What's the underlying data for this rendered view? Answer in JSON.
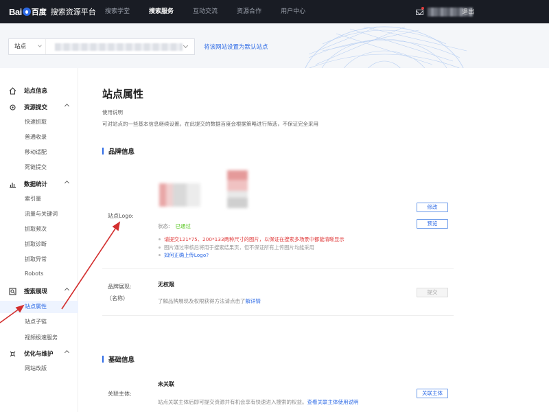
{
  "topbar": {
    "logo_bai": "Bai",
    "logo_baidu": "百度",
    "platform": "搜索资源平台",
    "nav": [
      "搜索学堂",
      "搜索服务",
      "互动交流",
      "资源合作",
      "用户中心"
    ],
    "active_nav_index": 1,
    "logout": "退出"
  },
  "sitebar": {
    "site_label": "站点",
    "set_default": "将该网站设置为默认站点"
  },
  "sidebar": {
    "site_info": "站点信息",
    "resource_submit": "资源提交",
    "resource_items": [
      "快速抓取",
      "普通收录",
      "移动适配",
      "死链提交"
    ],
    "data_stats": "数据统计",
    "data_items": [
      "索引量",
      "流量与关键词",
      "抓取频次",
      "抓取诊断",
      "抓取异常",
      "Robots"
    ],
    "search_display": "搜索展现",
    "display_items": [
      "站点属性",
      "站点子链",
      "视频极速服务"
    ],
    "active_item": "站点属性",
    "optimize": "优化与维护",
    "optimize_items": [
      "网站改版"
    ]
  },
  "main": {
    "title": "站点属性",
    "usage_title": "使用说明",
    "usage_desc": "可对站点的一些基本信息继续设置。在此提交的数据百度会根据策略进行筛选，不保证完全采用",
    "brand_section": "品牌信息",
    "logo_label": "站点Logo:",
    "status_label": "状态:",
    "status_value": "已通过",
    "notes": [
      "请提交121*75、200*133两种尺寸的图片，以保证在搜索多场景中都能清晰显示",
      "图片通过审核后将用于搜索结果页，但不保证所有上传图片均能采用",
      "如何正确上传Logo?"
    ],
    "btn_modify": "修改",
    "btn_preview": "预览",
    "brand_display_label": "品牌展现:",
    "brand_display_sub": "（名称）",
    "brand_display_value": "无权限",
    "brand_desc_prefix": "了解品牌展现及权限获得方法请点击了",
    "brand_desc_link": "解详情",
    "btn_submit": "提交",
    "basic_section": "基础信息",
    "assoc_label": "关联主体:",
    "assoc_value": "未关联",
    "assoc_desc_prefix": "站点关联主体后即可提交资源并有机会享有快速进入搜索的权益。",
    "assoc_desc_link": "查看关联主体使用说明",
    "btn_assoc": "关联主体"
  },
  "colors": {
    "topbar_bg": "#191c24",
    "accent": "#2e6be6",
    "warning": "#e03b3b",
    "success": "#52c41a",
    "annotation_arrow": "#d32f2f"
  }
}
